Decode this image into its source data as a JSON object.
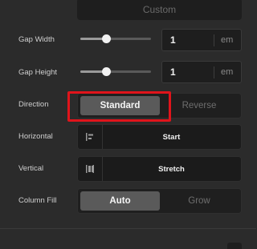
{
  "top_button": {
    "label": "Custom"
  },
  "gap_width": {
    "label": "Gap Width",
    "value": "1",
    "unit": "em",
    "slider_level": 0.36
  },
  "gap_height": {
    "label": "Gap Height",
    "value": "1",
    "unit": "em",
    "slider_level": 0.36
  },
  "direction": {
    "label": "Direction",
    "options": [
      "Standard",
      "Reverse"
    ],
    "selected": "Standard"
  },
  "horizontal": {
    "label": "Horizontal",
    "value": "Start",
    "icon": "align-start-icon"
  },
  "vertical": {
    "label": "Vertical",
    "value": "Stretch",
    "icon": "align-stretch-icon"
  },
  "column_fill": {
    "label": "Column Fill",
    "options": [
      "Auto",
      "Grow"
    ],
    "selected": "Auto"
  },
  "colors": {
    "highlight": "#e0141b",
    "panel": "#2b2b2b",
    "control": "#1e1e1e",
    "active": "#5a5a5a"
  }
}
